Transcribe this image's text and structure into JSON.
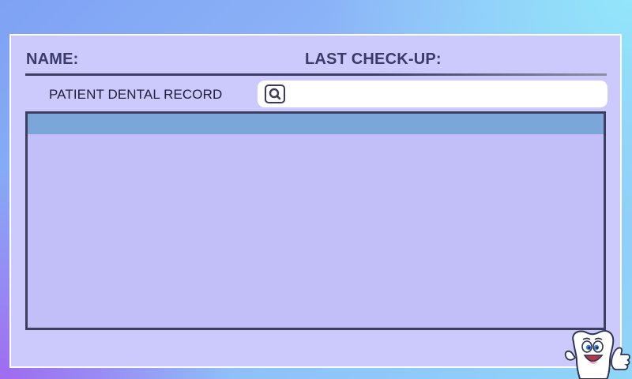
{
  "header": {
    "name_label": "NAME:",
    "last_checkup_label": "LAST CHECK-UP:"
  },
  "search": {
    "label": "PATIENT DENTAL RECORD",
    "value": "",
    "placeholder": "",
    "icon": "search-icon"
  },
  "records": {
    "rows": []
  },
  "mascot": {
    "icon": "tooth-mascot-icon"
  },
  "colors": {
    "card_background": "#cccafd",
    "panel_background": "#c2bff8",
    "panel_header": "#7aa6da",
    "text_dark": "#3a3a66",
    "border_dark": "#3d3f5c"
  }
}
